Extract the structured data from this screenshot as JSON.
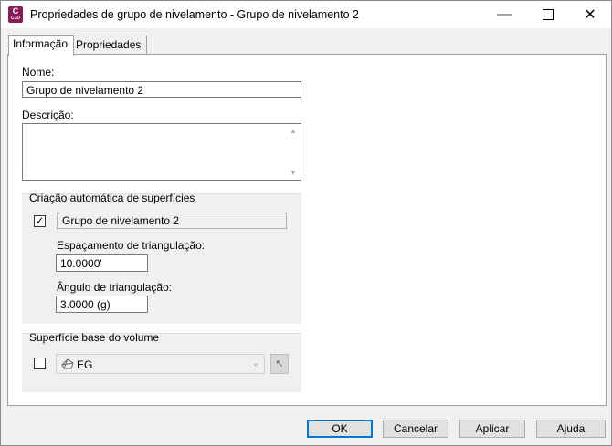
{
  "window": {
    "title": "Propriedades de grupo de nivelamento - Grupo de nivelamento 2",
    "app_icon_letter": "C",
    "app_icon_sub": "C3D"
  },
  "tabs": [
    {
      "label": "Informação",
      "active": true
    },
    {
      "label": "Propriedades",
      "active": false
    }
  ],
  "form": {
    "name_label": "Nome:",
    "name_value": "Grupo de nivelamento 2",
    "description_label": "Descrição:",
    "description_value": ""
  },
  "auto_surface": {
    "title": "Criação automática de superfícies",
    "checked": true,
    "check_mark": "✓",
    "surface_name": "Grupo de nivelamento 2",
    "spacing_label": "Espaçamento de triangulação:",
    "spacing_value": "10.0000'",
    "angle_label": "Ângulo de triangulação:",
    "angle_value": "3.0000 (g)"
  },
  "volume_base": {
    "title": "Superfície base do volume",
    "checked": false,
    "selected_surface": "EG"
  },
  "buttons": {
    "ok": "OK",
    "cancel": "Cancelar",
    "apply": "Aplicar",
    "help": "Ajuda"
  },
  "colors": {
    "accent": "#0078d7",
    "app_icon": "#8b1a5a"
  }
}
